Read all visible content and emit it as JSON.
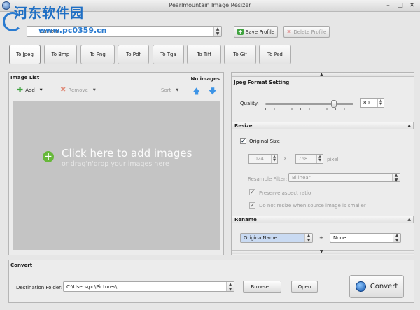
{
  "window": {
    "title": "Pearlmountain Image Resizer"
  },
  "watermark": {
    "text": "河东软件园",
    "url": "www.pc0359.cn"
  },
  "profile": {
    "selected": "Custom",
    "save_label": "Save Profile",
    "delete_label": "Delete Profile"
  },
  "tabs": [
    {
      "label": "To Jpeg"
    },
    {
      "label": "To Bmp"
    },
    {
      "label": "To Png"
    },
    {
      "label": "To Pdf"
    },
    {
      "label": "To Tga"
    },
    {
      "label": "To Tiff"
    },
    {
      "label": "To Gif"
    },
    {
      "label": "To Psd"
    }
  ],
  "image_list": {
    "title": "Image List",
    "status": "No images",
    "add_label": "Add",
    "remove_label": "Remove",
    "sort_label": "Sort",
    "drop_main": "Click here  to add images",
    "drop_sub": "or drag'n'drop your images here"
  },
  "jpeg": {
    "title": "Jpeg Format Setting",
    "quality_label": "Quality:",
    "quality_value": "80",
    "quality": 80
  },
  "resize": {
    "title": "Resize",
    "original_size_label": "Original Size",
    "width": "1024",
    "height": "768",
    "x_sep": "X",
    "unit": "pixel",
    "filter_label": "Resample Filter:",
    "filter_value": "Bilinear",
    "preserve_label": "Preserve aspect ratio",
    "no_enlarge_label": "Do not resize when source image is smaller"
  },
  "rename": {
    "title": "Rename",
    "left_value": "OriginalName",
    "plus": "+",
    "right_value": "None"
  },
  "convert": {
    "title": "Convert",
    "dest_label": "Destination Folder:",
    "dest_value": "C:\\Users\\pc\\Pictures\\",
    "browse_label": "Browse...",
    "open_label": "Open",
    "convert_label": "Convert"
  }
}
